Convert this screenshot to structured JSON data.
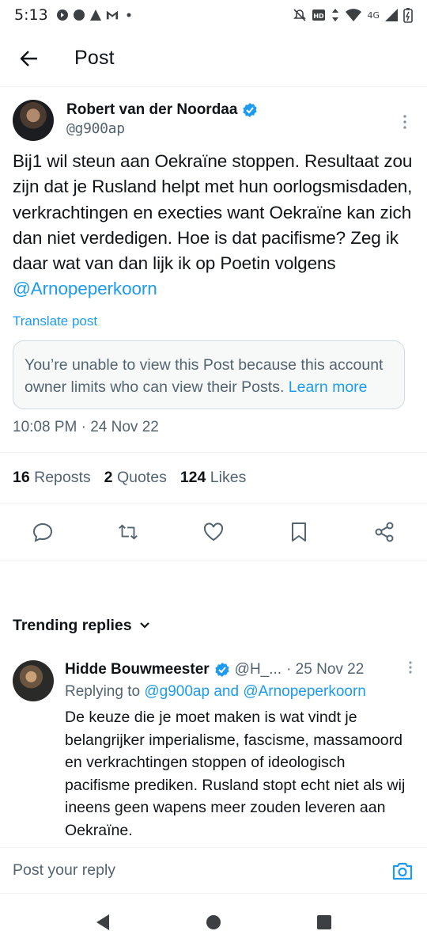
{
  "status_bar": {
    "time": "5:13",
    "network": "4G"
  },
  "header": {
    "title": "Post"
  },
  "post": {
    "author_name": "Robert van der Noordaa",
    "author_handle": "@g900ap",
    "text": "Bij1 wil steun aan Oekraïne stoppen. Resultaat zou zijn dat je Rusland helpt met hun oorlogsmisdaden, verkrachtingen en execties want Oekraïne kan zich dan niet verdedigen. Hoe is dat pacifisme? Zeg ik daar wat van dan lijk ik op Poetin volgens",
    "mention": "@Arnopeperkoorn",
    "translate_label": "Translate post",
    "restricted_notice": "You’re unable to view this Post because this account owner limits who can view their Posts.",
    "learn_more": "Learn more",
    "timestamp": "10:08 PM · 24 Nov 22",
    "stats": {
      "reposts_count": "16",
      "reposts_label": "Reposts",
      "quotes_count": "2",
      "quotes_label": "Quotes",
      "likes_count": "124",
      "likes_label": "Likes"
    },
    "actions": [
      "reply-icon",
      "repost-icon",
      "like-icon",
      "bookmark-icon",
      "share-icon"
    ]
  },
  "trending": {
    "label": "Trending replies"
  },
  "reply": {
    "author_name": "Hidde Bouwmeester",
    "author_handle": "@H_...",
    "date": "· 25 Nov 22",
    "replying_prefix": "Replying to",
    "replying_handle_1": "@g900ap",
    "replying_and": "and",
    "replying_handle_2": "@Arnopeperkoorn",
    "text": "De keuze die je moet maken is wat vindt je belangrijker imperialisme, fascisme, massamoord en verkrachtingen stoppen of ideologisch pacifisme prediken. Rusland stopt echt niet als wij ineens geen wapens meer zouden leveren aan Oekraïne."
  },
  "compose": {
    "placeholder": "Post your reply"
  },
  "colors": {
    "accent": "#1d9bf0",
    "text": "#0f1419",
    "muted": "#536471"
  }
}
